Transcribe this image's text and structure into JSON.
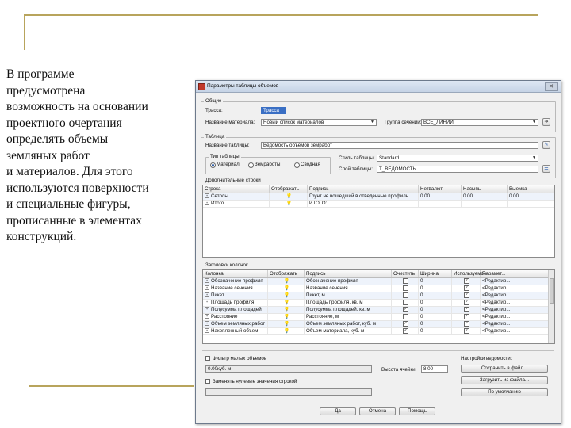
{
  "slide": {
    "text": "В программе\nпредусмотрена\nвозможность на основании\nпроектного очертания\nопределять объемы\nземляных работ\nи материалов. Для этого\nиспользуются поверхности\nи специальные фигуры,\nпрописанные в элементах\nконструкций."
  },
  "dialog": {
    "title": "Параметры таблицы объемов",
    "close_glyph": "✕",
    "general": {
      "group_label": "Общие",
      "route_label": "Трасса:",
      "route_value": "Трасса",
      "material_name_label": "Название материала:",
      "material_name_value": "Новый список материалов",
      "section_group_label": "Группа сечений:",
      "section_group_value": "ВСЕ_ЛИНИИ"
    },
    "table": {
      "group_label": "Таблица",
      "table_name_label": "Название таблицы:",
      "table_name_value": "Ведомость объемов земработ",
      "table_type_label": "Тип таблицы",
      "radio_options": [
        "Материал",
        "Земработы",
        "Сводная"
      ],
      "selected_radio": 0,
      "table_style_label": "Стиль таблицы:",
      "table_style_value": "Standard",
      "table_layer_label": "Слой таблицы:",
      "table_layer_value": "Т_ВЕДОМОСТЬ"
    },
    "extra_rows": {
      "group_label": "Дополнительные строки",
      "columns": [
        "Строка",
        "Отображать",
        "Подпись",
        "Нетвалют",
        "Насыпь",
        "Выемка"
      ],
      "rows": [
        {
          "name": "Сетолы",
          "label": "Грунт не вошедший в отведенные профиль",
          "v1": "0.00",
          "v2": "0.00",
          "v3": "0.00"
        },
        {
          "name": "Итого",
          "label": "ИТОГО:",
          "v1": "",
          "v2": "",
          "v3": ""
        }
      ]
    },
    "column_headers": {
      "group_label": "Заголовки колонок",
      "columns": [
        "Колонка",
        "Отображать",
        "Подпись",
        "Очистить",
        "Ширина",
        "Используемое",
        "Парамет..."
      ],
      "rows": [
        {
          "name": "Обозначение профиля",
          "label": "Обозначение профиля",
          "clear": false,
          "width": "0",
          "used": true,
          "param": "<Редактир..."
        },
        {
          "name": "Название сечения",
          "label": "Название сечения",
          "clear": false,
          "width": "0",
          "used": true,
          "param": "<Редактир..."
        },
        {
          "name": "Пикет",
          "label": "Пикет, м",
          "clear": false,
          "width": "0",
          "used": true,
          "param": "<Редактир..."
        },
        {
          "name": "Площадь профиля",
          "label": "Площадь профиля, кв. м",
          "clear": false,
          "width": "0",
          "used": true,
          "param": "<Редактир..."
        },
        {
          "name": "Полусумма площадей",
          "label": "Полусумма площадей, кв. м",
          "clear": true,
          "width": "0",
          "used": true,
          "param": "<Редактир..."
        },
        {
          "name": "Расстояние",
          "label": "Расстояние, м",
          "clear": false,
          "width": "0",
          "used": true,
          "param": "<Редактир..."
        },
        {
          "name": "Объем земляных работ",
          "label": "Объем земляных работ, куб. м",
          "clear": true,
          "width": "0",
          "used": true,
          "param": "<Редактир..."
        },
        {
          "name": "Накопленный объем",
          "label": "Объем материала, куб. м",
          "clear": true,
          "width": "0",
          "used": true,
          "param": "<Редактир..."
        }
      ]
    },
    "bottom": {
      "filter_label": "Фильтр малых объемов",
      "filter_value": "0.00куб. м",
      "replace_label": "Заменять нулевые значения строкой",
      "replace_value": "---",
      "cell_height_label": "Высота ячейки:",
      "cell_height_value": "8.00",
      "settings_label": "Настройки ведомости:",
      "save_button": "Сохранить в файл...",
      "load_button": "Загрузить из файла...",
      "default_button": "По умолчанию"
    },
    "footer": {
      "ok_button": "Да",
      "cancel_button": "Отмена",
      "help_button": "Помощь"
    }
  }
}
